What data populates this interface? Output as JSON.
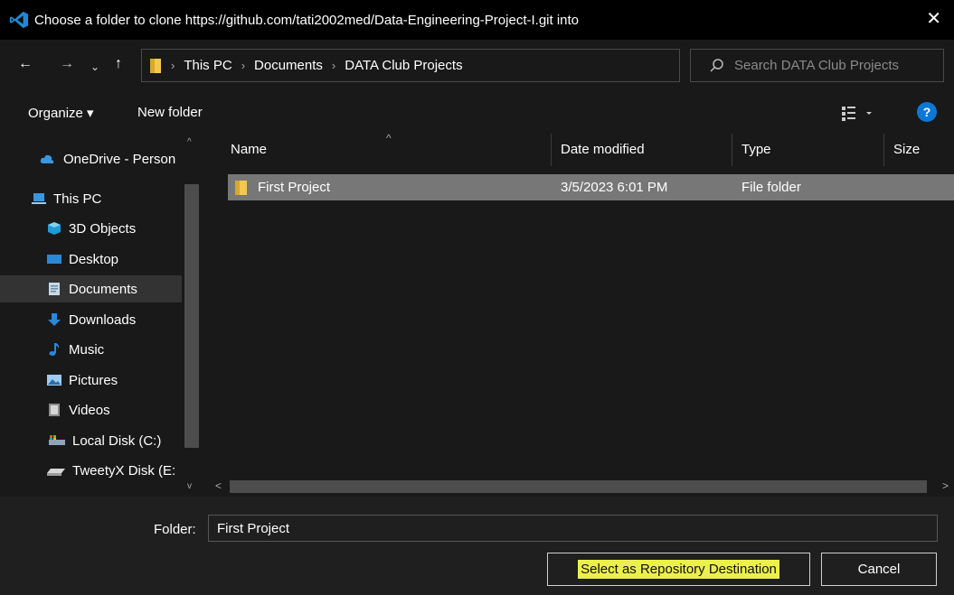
{
  "dialog": {
    "title": "Choose a folder to clone https://github.com/tati2002med/Data-Engineering-Project-I.git into",
    "close_symbol": "✕"
  },
  "navigation": {
    "back_symbol": "←",
    "forward_symbol": "→",
    "recent_symbol": "⌄",
    "up_symbol": "↑",
    "breadcrumbs": [
      "This PC",
      "Documents",
      "DATA Club Projects"
    ],
    "separator": "›",
    "dropdown_symbol": "⌄",
    "refresh_symbol": "↻"
  },
  "search": {
    "placeholder": "Search DATA Club Projects"
  },
  "toolbar": {
    "organize_label": "Organize ▾",
    "new_folder_label": "New folder",
    "help_label": "?"
  },
  "sidebar": {
    "items": [
      {
        "label": "OneDrive - Person",
        "icon": "cloud-icon"
      },
      {
        "label": "This PC",
        "icon": "computer-icon"
      },
      {
        "label": "3D Objects",
        "icon": "cube-icon"
      },
      {
        "label": "Desktop",
        "icon": "desktop-icon"
      },
      {
        "label": "Documents",
        "icon": "document-icon"
      },
      {
        "label": "Downloads",
        "icon": "download-icon"
      },
      {
        "label": "Music",
        "icon": "music-icon"
      },
      {
        "label": "Pictures",
        "icon": "picture-icon"
      },
      {
        "label": "Videos",
        "icon": "video-icon"
      },
      {
        "label": "Local Disk (C:)",
        "icon": "drive-icon"
      },
      {
        "label": "TweetyX Disk (E:",
        "icon": "external-drive-icon"
      }
    ],
    "selected": "Documents"
  },
  "file_list": {
    "columns": [
      "Name",
      "Date modified",
      "Type",
      "Size"
    ],
    "rows": [
      {
        "name": "First Project",
        "date_modified": "3/5/2023 6:01 PM",
        "type": "File folder",
        "size": ""
      }
    ]
  },
  "footer": {
    "folder_label": "Folder:",
    "folder_value": "First Project",
    "select_button_label": "Select as Repository Destination",
    "cancel_button_label": "Cancel"
  },
  "colors": {
    "accent": "#0a78d7",
    "highlight": "#ecf04e",
    "folder": "#f2c94c"
  }
}
